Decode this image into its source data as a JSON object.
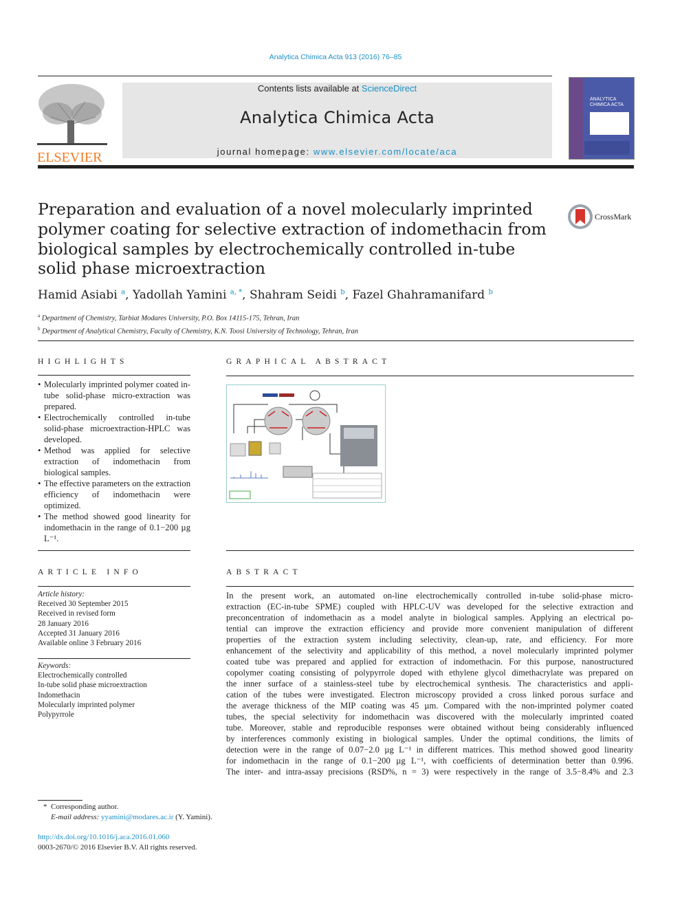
{
  "journal_ref": "Analytica Chimica Acta 913 (2016) 76–85",
  "masthead": {
    "contents_prefix": "Contents lists available at ",
    "contents_link": "ScienceDirect",
    "journal_title": "Analytica Chimica Acta",
    "homepage_prefix": "journal homepage: ",
    "homepage_link": "www.elsevier.com/locate/aca",
    "publisher_logo": "ELSEVIER",
    "cover_title": "ANALYTICA CHIMICA ACTA",
    "colors": {
      "elsevier_orange": "#f47b20",
      "link_blue": "#1a8fc4",
      "masthead_gray": "#e6e6e6",
      "cover_blue": "#4a5aa8"
    }
  },
  "article": {
    "title": "Preparation and evaluation of a novel molecularly imprinted polymer coating for selective extraction of indomethacin from biological samples by electrochemically controlled in-tube solid phase microextraction",
    "crossmark": "CrossMark",
    "authors": [
      {
        "name": "Hamid Asiabi",
        "aff": "a"
      },
      {
        "name": "Yadollah Yamini",
        "aff": "a, *"
      },
      {
        "name": "Shahram Seidi",
        "aff": "b"
      },
      {
        "name": "Fazel Ghahramanifard",
        "aff": "b"
      }
    ],
    "affiliations": [
      {
        "mark": "a",
        "text": "Department of Chemistry, Tarbiat Modares University, P.O. Box 14115-175, Tehran, Iran"
      },
      {
        "mark": "b",
        "text": "Department of Analytical Chemistry, Faculty of Chemistry, K.N. Toosi University of Technology, Tehran, Iran"
      }
    ]
  },
  "highlights": {
    "heading": "HIGHLIGHTS",
    "items": [
      "Molecularly imprinted polymer coated in-tube solid-phase micro-extraction was prepared.",
      "Electrochemically controlled in-tube solid-phase microextraction-HPLC was developed.",
      "Method was applied for selective extraction of indomethacin from biological samples.",
      "The effective parameters on the extraction efficiency of indomethacin were optimized.",
      "The method showed good linearity for indomethacin in the range of 0.1−200 µg L⁻¹."
    ]
  },
  "graphical_abstract": {
    "heading": "GRAPHICAL ABSTRACT"
  },
  "article_info": {
    "heading": "ARTICLE INFO",
    "history_label": "Article history:",
    "history": [
      "Received 30 September 2015",
      "Received in revised form",
      "28 January 2016",
      "Accepted 31 January 2016",
      "Available online 3 February 2016"
    ],
    "keywords_label": "Keywords:",
    "keywords": [
      "Electrochemically controlled",
      "In-tube solid phase microextraction",
      "Indomethacin",
      "Molecularly imprinted polymer",
      "Polypyrrole"
    ]
  },
  "abstract": {
    "heading": "ABSTRACT",
    "lines": [
      "In the present work, an automated on-line electrochemically controlled in-tube solid-phase micro-",
      "extraction (EC-in-tube SPME) coupled with HPLC-UV was developed for the selective extraction and",
      "preconcentration of indomethacin as a model analyte in biological samples. Applying an electrical po-",
      "tential can improve the extraction efficiency and provide more convenient manipulation of different",
      "properties of the extraction system including selectivity, clean-up, rate, and efficiency. For more",
      "enhancement of the selectivity and applicability of this method, a novel molecularly imprinted polymer",
      "coated tube was prepared and applied for extraction of indomethacin. For this purpose, nanostructured",
      "copolymer coating consisting of polypyrrole doped with ethylene glycol dimethacrylate was prepared on",
      "the inner surface of a stainless-steel tube by electrochemical synthesis. The characteristics and appli-",
      "cation of the tubes were investigated. Electron microscopy provided a cross linked porous surface and",
      "the average thickness of the MIP coating was 45 µm. Compared with the non-imprinted polymer coated",
      "tubes, the special selectivity for indomethacin was discovered with the molecularly imprinted coated",
      "tube. Moreover, stable and reproducible responses were obtained without being considerably influenced",
      "by interferences commonly existing in biological samples. Under the optimal conditions, the limits of",
      "detection were in the range of 0.07−2.0 µg L⁻¹ in different matrices. This method showed good linearity",
      "for indomethacin in the range of 0.1−200 µg L⁻¹, with coefficients of determination better than 0.996.",
      "The inter- and intra-assay precisions (RSD%, n = 3) were respectively in the range of 3.5−8.4% and 2.3"
    ]
  },
  "footnote": {
    "star": "*",
    "corresponding": "Corresponding author.",
    "email_label": "E-mail address:",
    "email": "yyamini@modares.ac.ir",
    "email_suffix": " (Y. Yamini).",
    "doi": "http://dx.doi.org/10.1016/j.aca.2016.01.060",
    "copyright": "0003-2670/© 2016 Elsevier B.V. All rights reserved."
  }
}
